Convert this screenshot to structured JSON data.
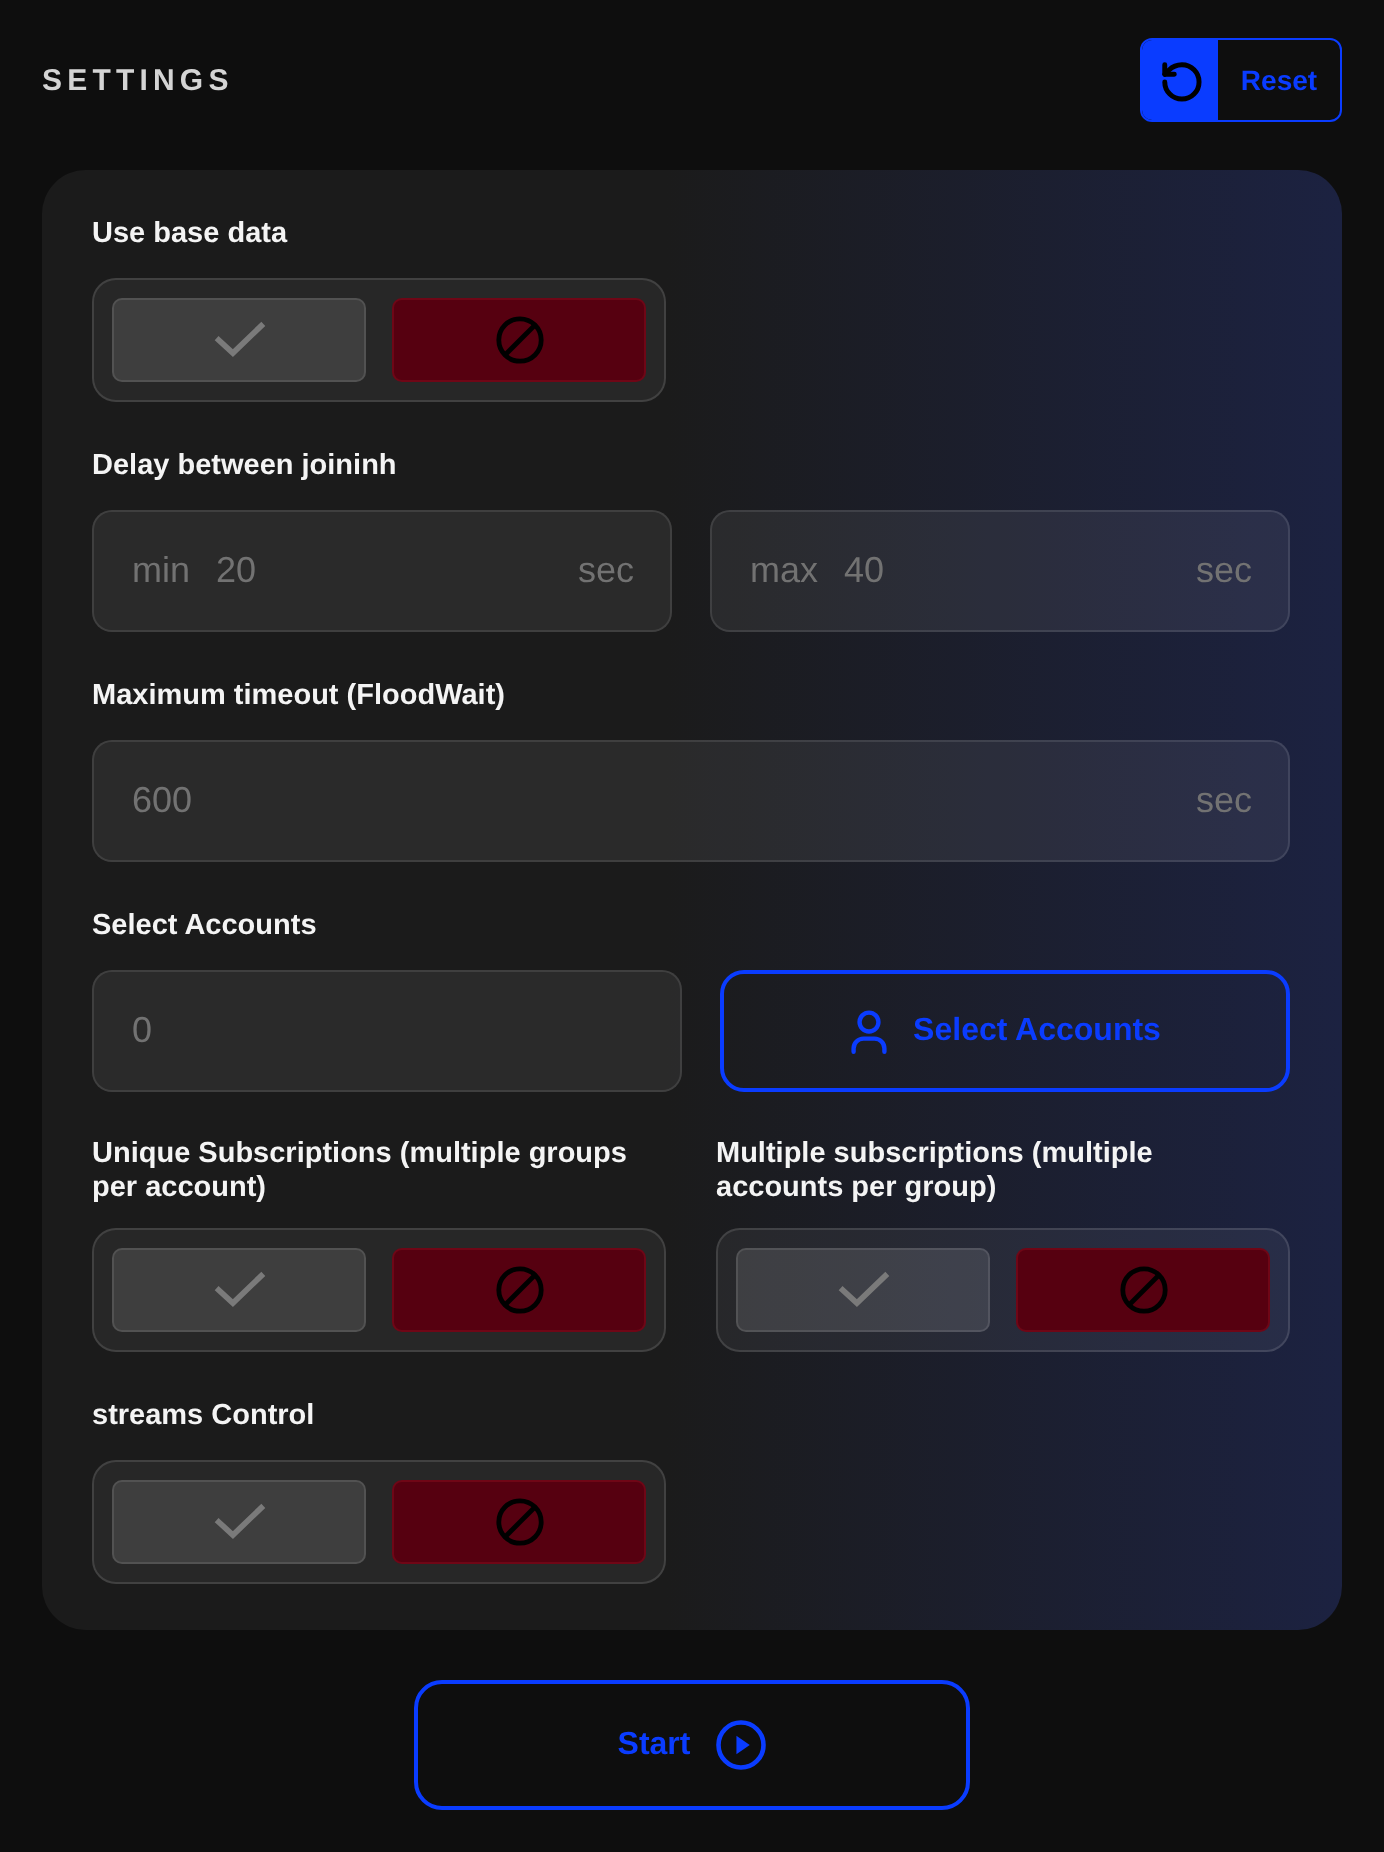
{
  "header": {
    "title": "SETTINGS",
    "reset_button": {
      "label": "Reset"
    }
  },
  "settings": [
    {
      "kind": "toggle",
      "label": "Use base data",
      "options": [
        {
          "kind": "yes",
          "selected": false
        },
        {
          "kind": "no",
          "selected": true
        }
      ]
    },
    {
      "kind": "range",
      "label": "Delay between joininh",
      "fields": [
        {
          "prefix": "min",
          "value": "20",
          "unit": "sec"
        },
        {
          "prefix": "max",
          "value": "40",
          "unit": "sec"
        }
      ]
    },
    {
      "kind": "number",
      "label": "Maximum timeout (FloodWait)",
      "field": {
        "value": "600",
        "unit": "sec"
      }
    },
    {
      "kind": "accounts",
      "label": "Select Accounts",
      "field": {
        "value": "0"
      },
      "button": {
        "label": "Select Accounts"
      }
    },
    {
      "kind": "toggle_pair",
      "items": [
        {
          "label": "Unique Subscriptions (multiple groups per account)",
          "options": [
            {
              "kind": "yes",
              "selected": false
            },
            {
              "kind": "no",
              "selected": true
            }
          ]
        },
        {
          "label": "Multiple subscriptions (multiple accounts per group)",
          "options": [
            {
              "kind": "yes",
              "selected": false
            },
            {
              "kind": "no",
              "selected": true
            }
          ]
        }
      ]
    },
    {
      "kind": "toggle",
      "label": "streams Control",
      "options": [
        {
          "kind": "yes",
          "selected": false
        },
        {
          "kind": "no",
          "selected": true
        }
      ]
    }
  ],
  "start_button": {
    "label": "Start"
  }
}
